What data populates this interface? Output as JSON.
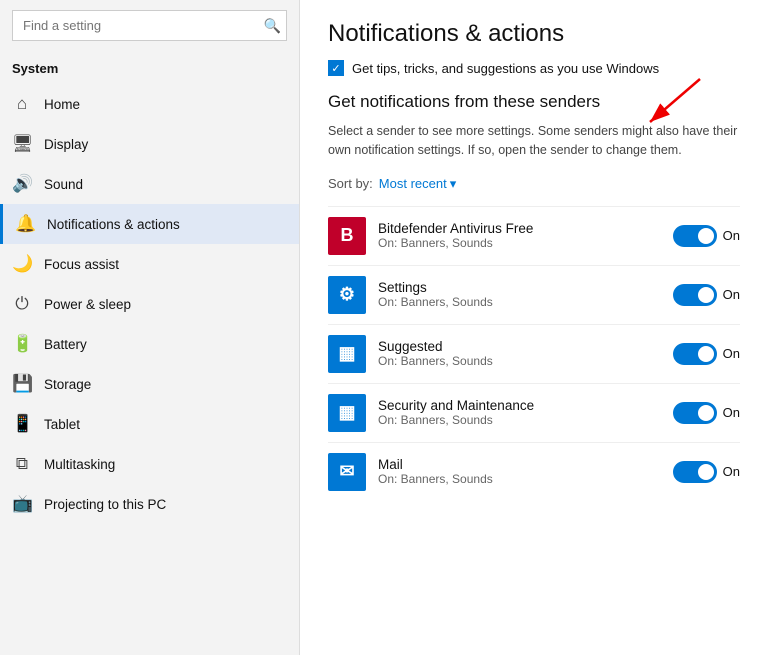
{
  "sidebar": {
    "title_partial": "S",
    "search_placeholder": "Find a setting",
    "system_label": "System",
    "home_label": "Home",
    "nav_items": [
      {
        "id": "home",
        "label": "Home",
        "icon": "⌂",
        "active": false
      },
      {
        "id": "display",
        "label": "Display",
        "icon": "🖥",
        "active": false
      },
      {
        "id": "sound",
        "label": "Sound",
        "icon": "🔊",
        "active": false
      },
      {
        "id": "notifications",
        "label": "Notifications & actions",
        "icon": "🔔",
        "active": true
      },
      {
        "id": "focus",
        "label": "Focus assist",
        "icon": "🌙",
        "active": false
      },
      {
        "id": "power",
        "label": "Power & sleep",
        "icon": "⏻",
        "active": false
      },
      {
        "id": "battery",
        "label": "Battery",
        "icon": "🔋",
        "active": false
      },
      {
        "id": "storage",
        "label": "Storage",
        "icon": "💾",
        "active": false
      },
      {
        "id": "tablet",
        "label": "Tablet",
        "icon": "📱",
        "active": false
      },
      {
        "id": "multitasking",
        "label": "Multitasking",
        "icon": "⧉",
        "active": false
      },
      {
        "id": "projecting",
        "label": "Projecting to this PC",
        "icon": "📺",
        "active": false
      }
    ]
  },
  "main": {
    "page_title": "Notifications & actions",
    "checkbox_text": "Get tips, tricks, and suggestions as you use Windows",
    "section_heading": "Get notifications from these senders",
    "description": "Select a sender to see more settings. Some senders might also have their own notification settings. If so, open the sender to change them.",
    "sort_label": "Sort by:",
    "sort_value": "Most recent",
    "senders": [
      {
        "id": "bitdefender",
        "name": "Bitdefender Antivirus Free",
        "sub": "On: Banners, Sounds",
        "icon_text": "B",
        "icon_bg": "#c0002a",
        "toggle_on": true,
        "toggle_label": "On"
      },
      {
        "id": "settings",
        "name": "Settings",
        "sub": "On: Banners, Sounds",
        "icon_text": "⚙",
        "icon_bg": "#0078d4",
        "toggle_on": true,
        "toggle_label": "On"
      },
      {
        "id": "suggested",
        "name": "Suggested",
        "sub": "On: Banners, Sounds",
        "icon_text": "▦",
        "icon_bg": "#0078d4",
        "toggle_on": true,
        "toggle_label": "On"
      },
      {
        "id": "security",
        "name": "Security and Maintenance",
        "sub": "On: Banners, Sounds",
        "icon_text": "▦",
        "icon_bg": "#0078d4",
        "toggle_on": true,
        "toggle_label": "On"
      },
      {
        "id": "mail",
        "name": "Mail",
        "sub": "On: Banners, Sounds",
        "icon_text": "✉",
        "icon_bg": "#0078d4",
        "toggle_on": true,
        "toggle_label": "On"
      }
    ]
  }
}
